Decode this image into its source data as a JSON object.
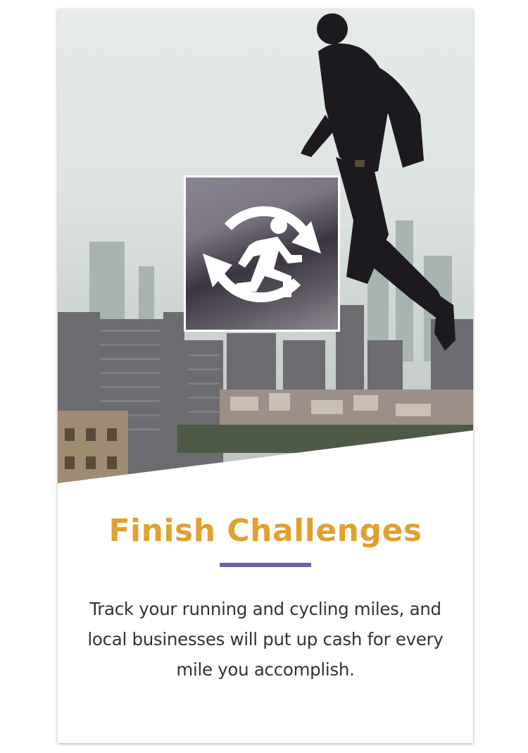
{
  "card": {
    "title": "Finish Challenges",
    "description": "Track your running and cycling miles, and local businesses will put up cash for every mile you accomplish."
  },
  "colors": {
    "title": "#e1a12e",
    "divider": "#6f5fb0",
    "text": "#333333"
  },
  "icons": {
    "badge": "running-person-refresh-icon"
  }
}
